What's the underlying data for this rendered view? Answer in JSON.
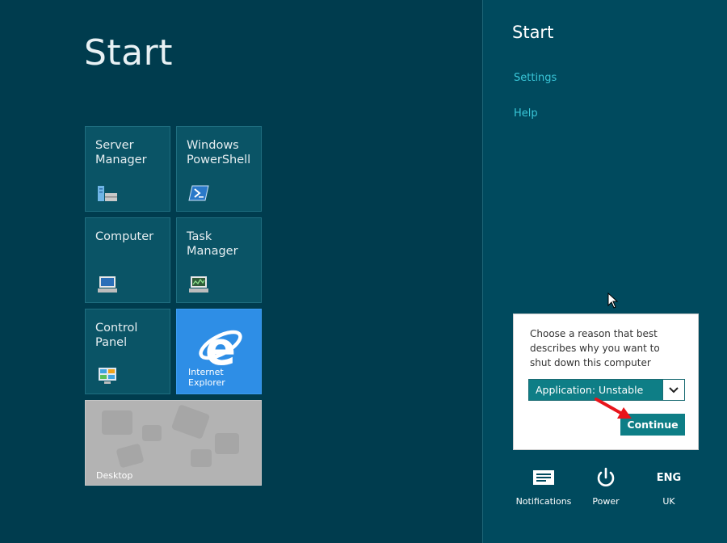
{
  "start_screen": {
    "title": "Start",
    "tiles": [
      {
        "label": "Server\nManager",
        "icon": "server-manager-icon"
      },
      {
        "label": "Windows\nPowerShell",
        "icon": "powershell-icon"
      },
      {
        "label": "Computer",
        "icon": "computer-icon"
      },
      {
        "label": "Task\nManager",
        "icon": "task-manager-icon"
      },
      {
        "label": "Control\nPanel",
        "icon": "control-panel-icon"
      },
      {
        "label": "Internet Explorer",
        "icon": "internet-explorer-icon"
      },
      {
        "label": "Desktop",
        "icon": "desktop-thumbnail"
      }
    ]
  },
  "charm_panel": {
    "title": "Start",
    "links": [
      "Settings",
      "Help"
    ],
    "dialog": {
      "prompt": "Choose a reason that best describes why you want to shut down this computer",
      "selected_reason": "Application: Unstable",
      "continue_label": "Continue"
    },
    "bottom": {
      "notifications_label": "Notifications",
      "power_label": "Power",
      "language_code": "ENG",
      "language_region": "UK"
    }
  },
  "colors": {
    "background": "#003c4e",
    "charm_panel": "#004a5e",
    "tile": "#0a5466",
    "ie_tile": "#2e8ee6",
    "accent_teal": "#0e7e86",
    "link": "#39c6d8",
    "annotation_arrow": "#e8141b"
  }
}
